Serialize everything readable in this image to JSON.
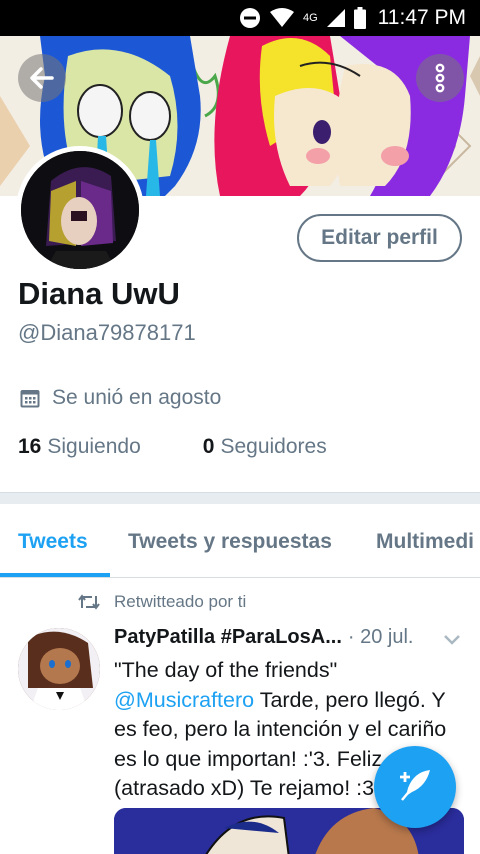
{
  "status_bar": {
    "network": "4G",
    "time": "11:47 PM"
  },
  "profile": {
    "name": "Diana UwU",
    "handle": "@Diana79878171",
    "joined": "Se unió en agosto",
    "following_count": "16",
    "following_label": "Siguiendo",
    "followers_count": "0",
    "followers_label": "Seguidores",
    "edit_button": "Editar perfil"
  },
  "tabs": [
    {
      "label": "Tweets",
      "active": true
    },
    {
      "label": "Tweets y respuestas",
      "active": false
    },
    {
      "label": "Multimedi",
      "active": false
    }
  ],
  "tweet": {
    "retweet_label": "Retwitteado por ti",
    "author": "PatyPatilla #ParaLosA...",
    "date": "· 20 jul.",
    "text_line1": "\"The day of the friends\"",
    "mention": "@Musicraftero",
    "text_rest": " Tarde, pero llegó. Y es feo, pero la intención y el cariño es lo que importan! :'3. Feliz día (atrasado xD) Te rejamo! :3"
  },
  "colors": {
    "accent": "#1da1f2",
    "secondary_text": "#657786",
    "primary_text": "#14171a"
  },
  "icons": {
    "back": "arrow-left-icon",
    "more": "vertical-dots-icon",
    "calendar": "calendar-icon",
    "retweet": "retweet-icon",
    "caret": "chevron-down-icon",
    "compose": "compose-feather-icon"
  }
}
